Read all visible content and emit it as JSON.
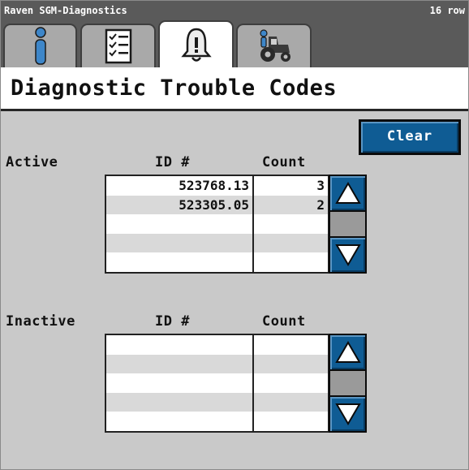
{
  "window": {
    "app_title": "Raven SGM-Diagnostics",
    "rows_label": "16 row"
  },
  "tabs": [
    {
      "id": "info",
      "icon": "info-icon",
      "active": false
    },
    {
      "id": "checklist",
      "icon": "checklist-icon",
      "active": false
    },
    {
      "id": "alarms",
      "icon": "alarm-bell-icon",
      "active": true
    },
    {
      "id": "tractor",
      "icon": "tractor-icon",
      "active": false
    }
  ],
  "page": {
    "title": "Diagnostic Trouble Codes"
  },
  "toolbar": {
    "clear_label": "Clear"
  },
  "active": {
    "label": "Active",
    "columns": {
      "id": "ID #",
      "count": "Count"
    },
    "rows": [
      {
        "id": "523768.13",
        "count": "3"
      },
      {
        "id": "523305.05",
        "count": "2"
      },
      {
        "id": "",
        "count": ""
      },
      {
        "id": "",
        "count": ""
      },
      {
        "id": "",
        "count": ""
      }
    ]
  },
  "inactive": {
    "label": "Inactive",
    "columns": {
      "id": "ID #",
      "count": "Count"
    },
    "rows": [
      {
        "id": "",
        "count": ""
      },
      {
        "id": "",
        "count": ""
      },
      {
        "id": "",
        "count": ""
      },
      {
        "id": "",
        "count": ""
      },
      {
        "id": "",
        "count": ""
      }
    ]
  },
  "colors": {
    "accent_blue": "#0f5c94",
    "background": "#c9c9c9",
    "titlebar": "#5a5a5a"
  }
}
